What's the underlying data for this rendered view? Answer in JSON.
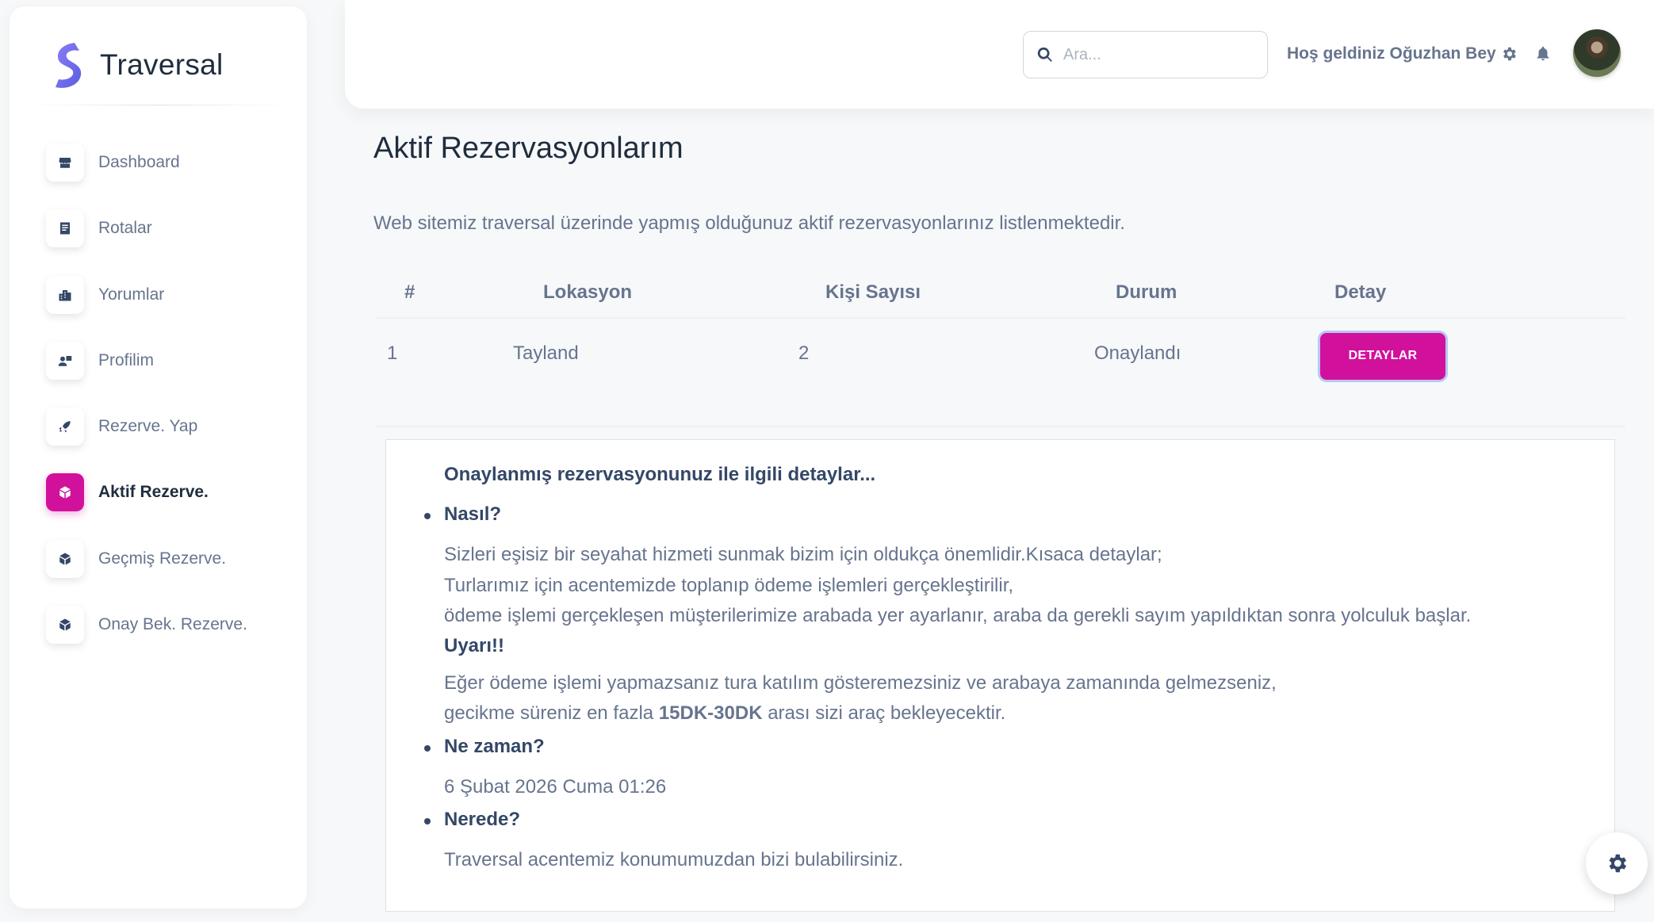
{
  "brand": {
    "name": "Traversal",
    "logo_icon": "traversal-s-logo"
  },
  "sidebar": {
    "items": [
      {
        "label": "Dashboard",
        "icon": "shop-icon",
        "active": false
      },
      {
        "label": "Rotalar",
        "icon": "document-icon",
        "active": false
      },
      {
        "label": "Yorumlar",
        "icon": "office-icon",
        "active": false
      },
      {
        "label": "Profilim",
        "icon": "user-card-icon",
        "active": false
      },
      {
        "label": "Rezerve. Yap",
        "icon": "rocket-icon",
        "active": false
      },
      {
        "label": "Aktif Rezerve.",
        "icon": "cube-icon",
        "active": true
      },
      {
        "label": "Geçmiş Rezerve.",
        "icon": "cube-icon",
        "active": false
      },
      {
        "label": "Onay Bek. Rezerve.",
        "icon": "cube-icon",
        "active": false
      }
    ]
  },
  "topbar": {
    "search_placeholder": "Ara...",
    "greeting": "Hoş geldiniz Oğuzhan Bey",
    "icons": [
      "search-icon",
      "gear-icon",
      "bell-icon",
      "avatar"
    ]
  },
  "page": {
    "title": "Aktif Rezervasyonlarım",
    "description": "Web sitemiz traversal üzerinde yapmış olduğunuz aktif rezervasyonlarınız listlenmektedir."
  },
  "table": {
    "headers": [
      "#",
      "Lokasyon",
      "Kişi Sayısı",
      "Durum",
      "Detay"
    ],
    "rows": [
      {
        "no": "1",
        "location": "Tayland",
        "people": "2",
        "status": "Onaylandı",
        "button": "DETAYLAR"
      }
    ]
  },
  "details": {
    "heading": "Onaylanmış rezervasyonunuz ile ilgili detaylar...",
    "how_title": "Nasıl?",
    "how_lines": [
      "Sizleri eşisiz bir seyahat hizmeti sunmak bizim için oldukça önemlidir.Kısaca detaylar;",
      "Turlarımız için acentemizde toplanıp ödeme işlemleri gerçekleştirilir,",
      "ödeme işlemi gerçekleşen müşterilerimize arabada yer ayarlanır, araba da gerekli sayım yapıldıktan sonra yolculuk başlar."
    ],
    "warning_title": "Uyarı!!",
    "warning_line1": "Eğer ödeme işlemi yapmazsanız tura katılım gösteremezsiniz ve arabaya zamanında gelmezseniz,",
    "warning_line2_pre": "gecikme süreniz en fazla",
    "warning_line2_bold": "15DK-30DK",
    "warning_line2_post": "arası sizi araç bekleyecektir.",
    "when_title": "Ne zaman?",
    "when_value": "6 Şubat 2026 Cuma 01:26",
    "where_title": "Nerede?",
    "where_value": "Traversal acentemiz konumumuzdan bizi bulabilirsiniz."
  },
  "colors": {
    "accent": "#d1119b",
    "text_dark": "#344767",
    "text_muted": "#67748e"
  }
}
